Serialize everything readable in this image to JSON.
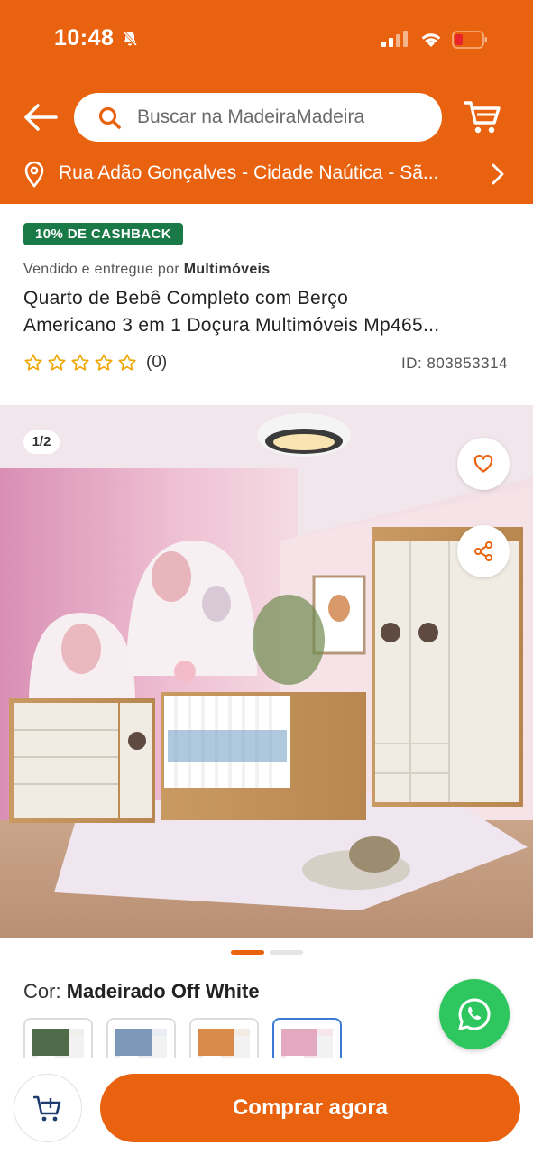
{
  "status": {
    "time": "10:48"
  },
  "search": {
    "placeholder": "Buscar na MadeiraMadeira"
  },
  "address": {
    "text": "Rua Adão Gonçalves - Cidade Naútica - Sã..."
  },
  "product": {
    "cashback": "10% DE CASHBACK",
    "seller_prefix": "Vendido e entregue por",
    "seller": "Multimóveis",
    "title_line1": "Quarto de Bebê Completo com Berço",
    "title_line2": "Americano 3 em 1 Doçura Multimóveis Mp465...",
    "rating_count": "(0)",
    "id": "ID: 803853314",
    "rating": 0
  },
  "gallery": {
    "pager": "1/2",
    "current": 1,
    "total": 2
  },
  "color": {
    "label": "Cor:",
    "value": "Madeirado Off White",
    "options": [
      "verde",
      "azul",
      "laranja",
      "rosa"
    ],
    "selected": 3
  },
  "actions": {
    "buy": "Comprar agora"
  },
  "colors": {
    "brand": "#e8620f",
    "cashback": "#1a7a47",
    "whatsapp": "#2ec65f",
    "selected": "#3a7bd5"
  }
}
